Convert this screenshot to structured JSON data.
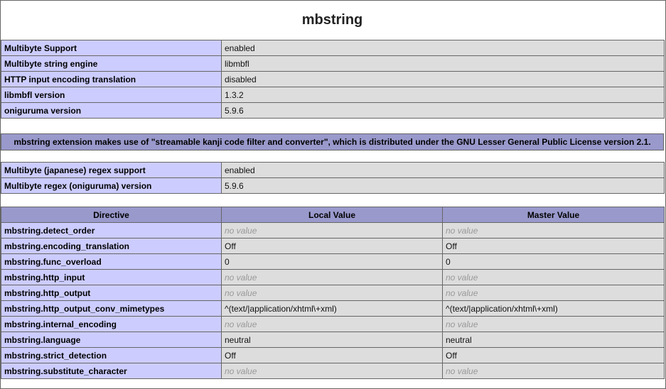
{
  "title": "mbstring",
  "info_table": [
    {
      "name": "Multibyte Support",
      "value": "enabled"
    },
    {
      "name": "Multibyte string engine",
      "value": "libmbfl"
    },
    {
      "name": "HTTP input encoding translation",
      "value": "disabled"
    },
    {
      "name": "libmbfl version",
      "value": "1.3.2"
    },
    {
      "name": "oniguruma version",
      "value": "5.9.6"
    }
  ],
  "license_note": "mbstring extension makes use of \"streamable kanji code filter and converter\", which is distributed under the GNU Lesser General Public License version 2.1.",
  "regex_table": [
    {
      "name": "Multibyte (japanese) regex support",
      "value": "enabled"
    },
    {
      "name": "Multibyte regex (oniguruma) version",
      "value": "5.9.6"
    }
  ],
  "directives": {
    "headers": [
      "Directive",
      "Local Value",
      "Master Value"
    ],
    "rows": [
      {
        "name": "mbstring.detect_order",
        "local": "no value",
        "master": "no value",
        "local_nv": true,
        "master_nv": true
      },
      {
        "name": "mbstring.encoding_translation",
        "local": "Off",
        "master": "Off",
        "local_nv": false,
        "master_nv": false
      },
      {
        "name": "mbstring.func_overload",
        "local": "0",
        "master": "0",
        "local_nv": false,
        "master_nv": false
      },
      {
        "name": "mbstring.http_input",
        "local": "no value",
        "master": "no value",
        "local_nv": true,
        "master_nv": true
      },
      {
        "name": "mbstring.http_output",
        "local": "no value",
        "master": "no value",
        "local_nv": true,
        "master_nv": true
      },
      {
        "name": "mbstring.http_output_conv_mimetypes",
        "local": "^(text/|application/xhtml\\+xml)",
        "master": "^(text/|application/xhtml\\+xml)",
        "local_nv": false,
        "master_nv": false
      },
      {
        "name": "mbstring.internal_encoding",
        "local": "no value",
        "master": "no value",
        "local_nv": true,
        "master_nv": true
      },
      {
        "name": "mbstring.language",
        "local": "neutral",
        "master": "neutral",
        "local_nv": false,
        "master_nv": false
      },
      {
        "name": "mbstring.strict_detection",
        "local": "Off",
        "master": "Off",
        "local_nv": false,
        "master_nv": false
      },
      {
        "name": "mbstring.substitute_character",
        "local": "no value",
        "master": "no value",
        "local_nv": true,
        "master_nv": true
      }
    ]
  }
}
